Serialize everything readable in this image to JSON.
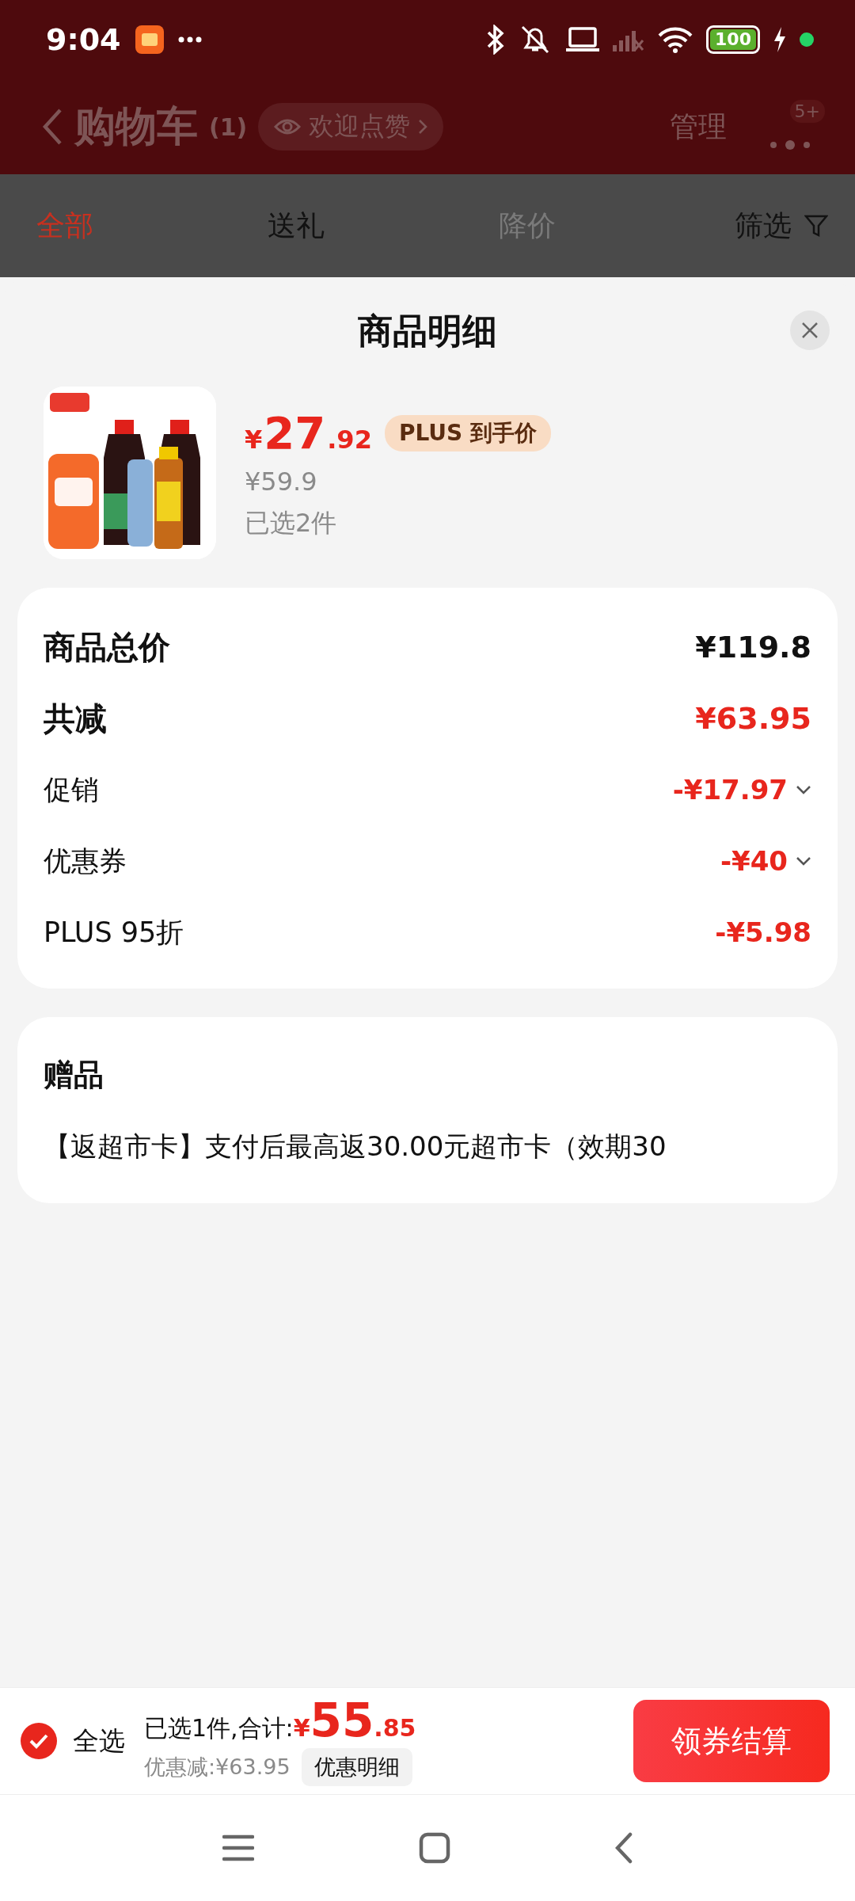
{
  "status_bar": {
    "time": "9:04",
    "battery": "100"
  },
  "header": {
    "title": "购物车",
    "count": "(1)",
    "like_chip": "欢迎点赞",
    "manage": "管理",
    "badge": "5+"
  },
  "tabs": [
    {
      "label": "全部",
      "selected": true,
      "disabled": false
    },
    {
      "label": "送礼",
      "selected": false,
      "disabled": false
    },
    {
      "label": "降价",
      "selected": false,
      "disabled": true
    }
  ],
  "filter": "筛选",
  "sheet": {
    "title": "商品明细",
    "product": {
      "currency": "¥",
      "price_int": "27",
      "price_dec": ".92",
      "badge": "PLUS 到手价",
      "original_price": "¥59.9",
      "selected_count": "已选2件"
    },
    "summary": [
      {
        "kind": "total",
        "label": "商品总价",
        "value": "¥119.8",
        "expandable": false
      },
      {
        "kind": "total_discount",
        "label": "共减",
        "value": "¥63.95",
        "expandable": false
      },
      {
        "kind": "item",
        "label": "促销",
        "value": "-¥17.97",
        "expandable": true
      },
      {
        "kind": "item",
        "label": "优惠券",
        "value": "-¥40",
        "expandable": true
      },
      {
        "kind": "item",
        "label": "PLUS 95折",
        "value": "-¥5.98",
        "expandable": false
      }
    ],
    "gift": {
      "title": "赠品",
      "text": "【返超市卡】支付后最高返30.00元超市卡（效期30"
    }
  },
  "checkout": {
    "select_all": {
      "label": "全选",
      "checked": true
    },
    "summary": "已选1件,合计:",
    "currency": "¥",
    "total_int": "55",
    "total_dec": ".85",
    "discount": "优惠减:¥63.95",
    "detail_button": "优惠明细",
    "submit": "领券结算"
  }
}
